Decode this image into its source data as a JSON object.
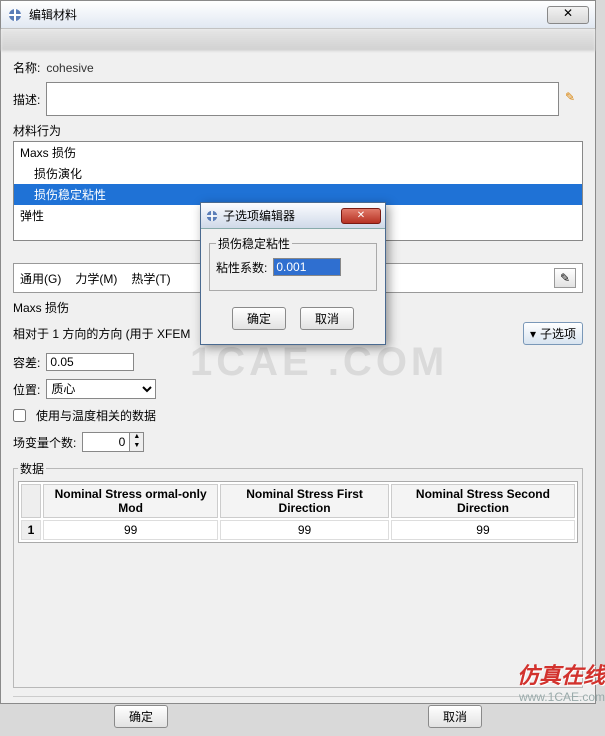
{
  "window": {
    "title": "编辑材料",
    "close_glyph": "✕"
  },
  "form": {
    "name_label": "名称:",
    "name_value": "cohesive",
    "desc_label": "描述:",
    "desc_value": ""
  },
  "behavior_group": "材料行为",
  "tree": {
    "root": "Maxs 损伤",
    "child_evolution": "损伤演化",
    "child_stability": "损伤稳定粘性",
    "elastic": "弹性"
  },
  "tabs": {
    "general": "通用(G)",
    "mechanics": "力学(M)",
    "thermal": "热学(T)"
  },
  "section": {
    "heading": "Maxs 损伤",
    "relative_dir": "相对于 1 方向的方向 (用于 XFEM",
    "subopt_btn": "子选项",
    "tol_label": "容差:",
    "tol_value": "0.05",
    "pos_label": "位置:",
    "pos_value": "质心",
    "temp_check": "使用与温度相关的数据",
    "fieldvar_label": "场变量个数:",
    "fieldvar_value": "0",
    "data_group": "数据"
  },
  "table": {
    "cols": [
      "Nominal Stress ormal-only Mod",
      "Nominal Stress First Direction",
      "Nominal Stress Second Direction"
    ],
    "row_index": "1",
    "row": [
      "99",
      "99",
      "99"
    ]
  },
  "footer": {
    "ok": "确定",
    "cancel": "取消"
  },
  "child_dialog": {
    "title": "子选项编辑器",
    "group": "损伤稳定粘性",
    "coef_label": "粘性系数:",
    "coef_value": "0.001",
    "ok": "确定",
    "cancel": "取消"
  },
  "watermark": {
    "big": "1CAE .COM",
    "brand": "仿真在线",
    "url": "www.1CAE.com"
  }
}
